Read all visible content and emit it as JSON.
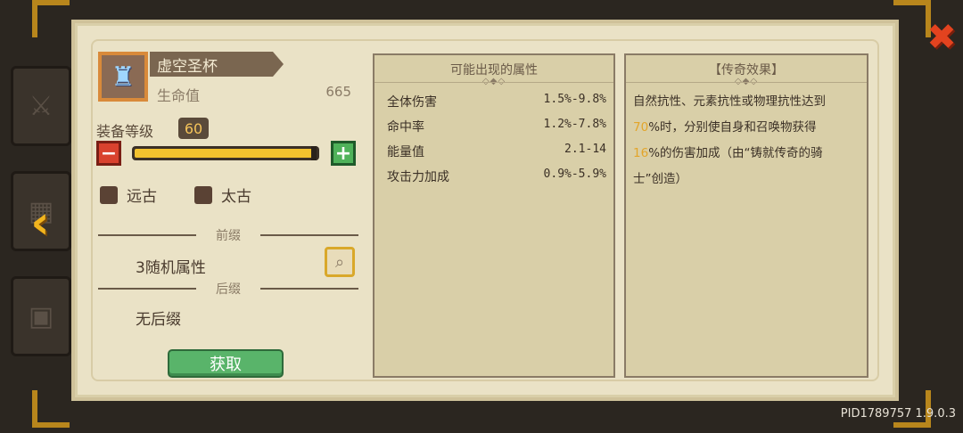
{
  "item": {
    "name": "虚空圣杯",
    "stat_label": "生命值",
    "stat_value": "665"
  },
  "level": {
    "label": "装备等级",
    "value": "60",
    "progress": 1.0
  },
  "checkboxes": [
    {
      "label": "远古",
      "checked": false
    },
    {
      "label": "太古",
      "checked": false
    }
  ],
  "prefix": {
    "header": "前缀",
    "value": "3随机属性"
  },
  "suffix": {
    "header": "后缀",
    "value": "无后缀"
  },
  "get_button": "获取",
  "attributes": {
    "title": "可能出现的属性",
    "rows": [
      {
        "name": "全体伤害",
        "range": "1.5%-9.8%"
      },
      {
        "name": "命中率",
        "range": "1.2%-7.8%"
      },
      {
        "name": "能量值",
        "range": "2.1-14"
      },
      {
        "name": "攻击力加成",
        "range": "0.9%-5.9%"
      }
    ]
  },
  "legend": {
    "title": "【传奇效果】",
    "line1": "自然抗性、元素抗性或物理抗性达到",
    "num1": "70",
    "line2": "%时，分别使自身和召唤物获得",
    "num2": "16",
    "line3": "%的伤害加成（由“铸就传奇的骑",
    "line4": "士”创造）"
  },
  "version": "PID1789757 1.9.0.3",
  "colors": {
    "highlight": "#e3a52a",
    "close": "#e3431f",
    "get_button": "#59b46a"
  }
}
